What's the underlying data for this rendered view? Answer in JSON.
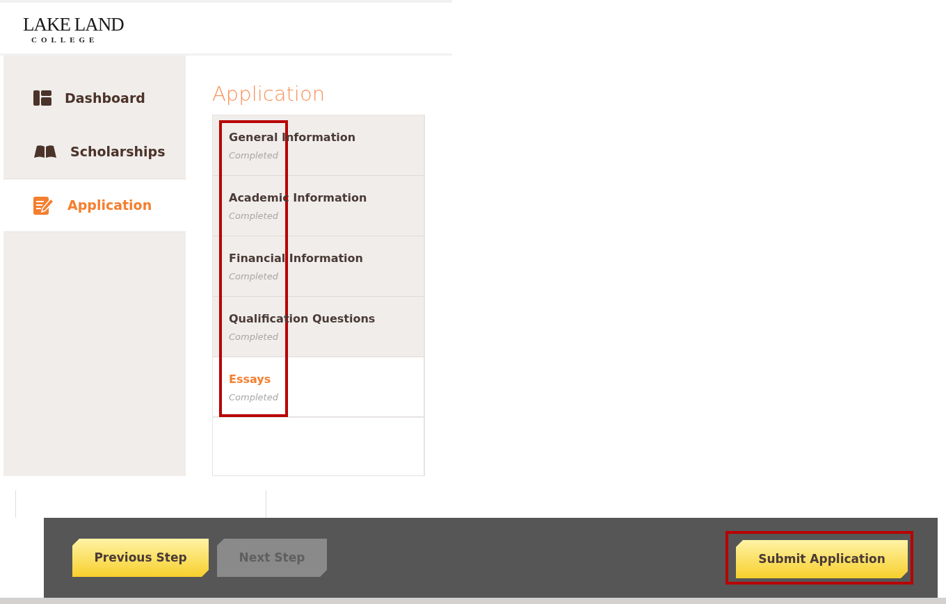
{
  "logo": {
    "name": "LAKE LAND",
    "subtitle": "COLLEGE"
  },
  "sidebar": {
    "items": [
      {
        "label": "Dashboard",
        "kind": "dashboard",
        "selected": false
      },
      {
        "label": "Scholarships",
        "kind": "book",
        "selected": false
      },
      {
        "label": "Application",
        "kind": "edit",
        "selected": true
      }
    ]
  },
  "heading": "Application",
  "steps": {
    "highlighted": true,
    "items": [
      {
        "title": "General Information",
        "status": "Completed",
        "selected": false
      },
      {
        "title": "Academic Information",
        "status": "Completed",
        "selected": false
      },
      {
        "title": "Financial Information",
        "status": "Completed",
        "selected": false
      },
      {
        "title": "Qualification Questions",
        "status": "Completed",
        "selected": false
      },
      {
        "title": "Essays",
        "status": "Completed",
        "selected": true
      }
    ]
  },
  "footer": {
    "buttons": [
      {
        "label": "Previous Step",
        "disabled": false
      },
      {
        "label": "Next Step",
        "disabled": true
      },
      {
        "label": "Submit Application",
        "disabled": false,
        "highlighted": true
      }
    ]
  }
}
